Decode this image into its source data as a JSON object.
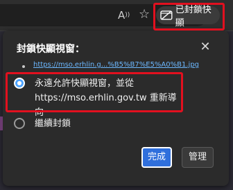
{
  "toolbar": {
    "read_aloud_glyph": "A",
    "favorite_glyph": "☆",
    "blocked_label": "已封鎖快顯"
  },
  "popup": {
    "title": "封鎖快顯視窗：",
    "close_glyph": "✕",
    "blocked_link": "https://mso.erhlin.g...%B5%B7%E5%A0%B1.jpg",
    "options": [
      {
        "label": "永遠允許快顯視窗，並從 https://mso.erhlin.gov.tw 重新導向",
        "checked": true
      },
      {
        "label": "繼續封鎖",
        "checked": false
      }
    ],
    "buttons": {
      "done": "完成",
      "manage": "管理"
    }
  },
  "colors": {
    "highlight": "#e2101f",
    "primary": "#2f6fdc",
    "link": "#6cb8ff"
  }
}
